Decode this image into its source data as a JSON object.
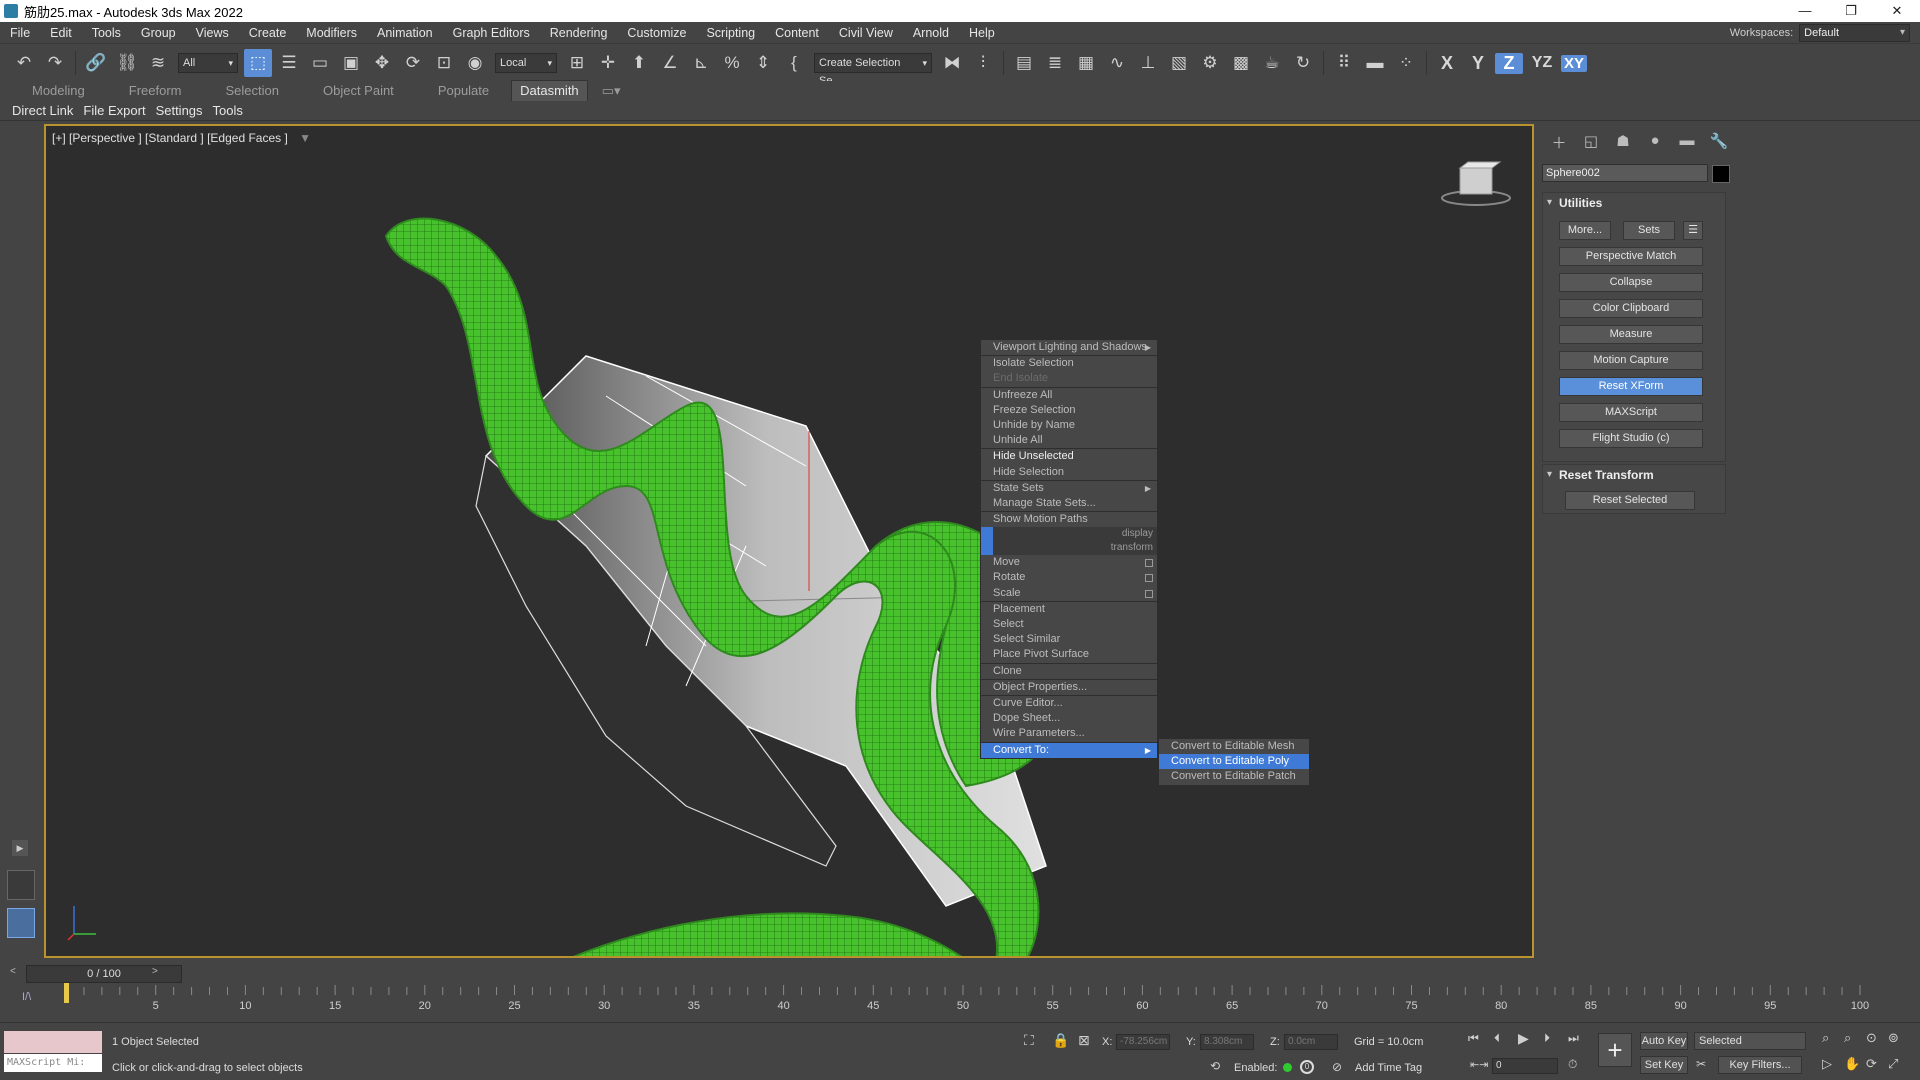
{
  "window": {
    "title": "筋肋25.max - Autodesk 3ds Max 2022",
    "controls": [
      "—",
      "❐",
      "✕"
    ]
  },
  "menubar": [
    "File",
    "Edit",
    "Tools",
    "Group",
    "Views",
    "Create",
    "Modifiers",
    "Animation",
    "Graph Editors",
    "Rendering",
    "Customize",
    "Scripting",
    "Content",
    "Civil View",
    "Arnold",
    "Help"
  ],
  "workspaces": {
    "label": "Workspaces:",
    "value": "Default"
  },
  "toolbar": {
    "filter_value": "All",
    "coord_value": "Local",
    "selection_set_placeholder": "Create Selection Se",
    "axes": [
      "X",
      "Y",
      "Z",
      "YZ",
      "XY"
    ],
    "active_axis": "Z"
  },
  "ribbon": {
    "tabs": [
      "Modeling",
      "Freeform",
      "Selection",
      "Object Paint",
      "Populate",
      "Datasmith"
    ],
    "active": "Datasmith"
  },
  "subbar": [
    "Direct Link",
    "File Export",
    "Settings",
    "Tools"
  ],
  "viewport": {
    "label": "[+] [Perspective ] [Standard ] [Edged Faces ]"
  },
  "context_menu": {
    "display_header": "display",
    "transform_header": "transform",
    "display_items": [
      {
        "label": "Viewport Lighting and Shadows",
        "arrow": true
      },
      {
        "label": "Isolate Selection"
      },
      {
        "label": "End Isolate",
        "dim": true
      },
      {
        "label": "Unfreeze All"
      },
      {
        "label": "Freeze Selection"
      },
      {
        "label": "Unhide by Name"
      },
      {
        "label": "Unhide All"
      },
      {
        "label": "Hide Unselected",
        "bright": true
      },
      {
        "label": "Hide Selection"
      },
      {
        "label": "State Sets",
        "arrow": true
      },
      {
        "label": "Manage State Sets..."
      },
      {
        "label": "Show Motion Paths"
      }
    ],
    "transform_items": [
      {
        "label": "Move",
        "box": true
      },
      {
        "label": "Rotate",
        "box": true
      },
      {
        "label": "Scale",
        "box": true
      },
      {
        "label": "Placement"
      },
      {
        "label": "Select"
      },
      {
        "label": "Select Similar"
      },
      {
        "label": "Place Pivot Surface"
      },
      {
        "label": "Clone"
      },
      {
        "label": "Object Properties..."
      },
      {
        "label": "Curve Editor..."
      },
      {
        "label": "Dope Sheet..."
      },
      {
        "label": "Wire Parameters..."
      },
      {
        "label": "Convert To:",
        "arrow": true,
        "highlight": true
      }
    ],
    "submenu": [
      {
        "label": "Convert to Editable Mesh"
      },
      {
        "label": "Convert to Editable Poly",
        "highlight": true
      },
      {
        "label": "Convert to Editable Patch"
      }
    ]
  },
  "command_panel": {
    "object_name": "Sphere002",
    "utilities": {
      "title": "Utilities",
      "more": "More...",
      "sets": "Sets",
      "buttons": [
        "Perspective Match",
        "Collapse",
        "Color Clipboard",
        "Measure",
        "Motion Capture",
        "Reset XForm",
        "MAXScript",
        "Flight Studio (c)"
      ],
      "active": "Reset XForm"
    },
    "reset_transform": {
      "title": "Reset Transform",
      "button": "Reset Selected"
    }
  },
  "timeline": {
    "slider": "0 / 100",
    "ticks": [
      "5",
      "10",
      "15",
      "20",
      "25",
      "30",
      "35",
      "40",
      "45",
      "50",
      "55",
      "60",
      "65",
      "70",
      "75",
      "80",
      "85",
      "90",
      "95",
      "100"
    ]
  },
  "status": {
    "maxscript": "MAXScript Mi:",
    "selected": "1 Object Selected",
    "prompt": "Click or click-and-drag to select objects",
    "x_label": "X:",
    "x_value": "-78.256cm",
    "y_label": "Y:",
    "y_value": "8.308cm",
    "z_label": "Z:",
    "z_value": "0.0cm",
    "grid": "Grid = 10.0cm",
    "enabled": "Enabled:",
    "add_time_tag": "Add Time Tag",
    "auto_key": "Auto Key",
    "selected_dropdown": "Selected",
    "set_key": "Set Key",
    "key_filters": "Key Filters...",
    "frame_value": "0"
  },
  "colors": {
    "accent": "#5b8ed6",
    "viewport_border": "#b9932d",
    "mesh_green": "#3fb828"
  }
}
